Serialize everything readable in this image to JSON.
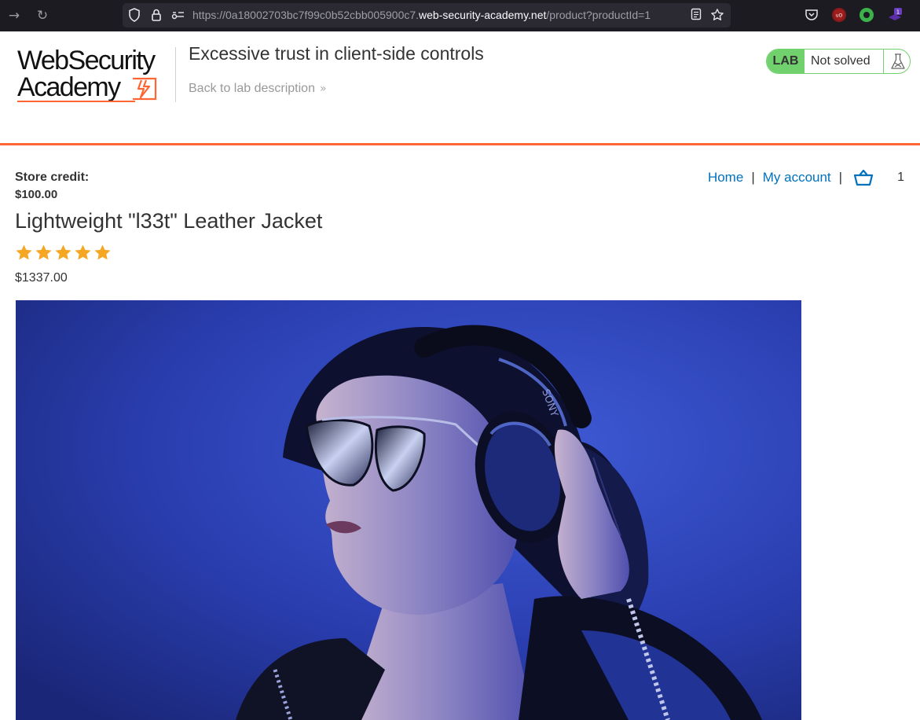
{
  "browser": {
    "url_prefix": "https://0a18002703bc7f99c0b52cbb005900c7.",
    "url_domain": "web-security-academy.net",
    "url_path": "/product?productId=1",
    "extension_badge": "1"
  },
  "header": {
    "logo_line1": "WebSecurity",
    "logo_line2": "Academy",
    "lab_title": "Excessive trust in client-side controls",
    "back_link": "Back to lab description",
    "lab_label": "LAB",
    "lab_status": "Not solved"
  },
  "account": {
    "credit_label": "Store credit:",
    "credit_value": "$100.00"
  },
  "nav": {
    "home": "Home",
    "separator": "|",
    "my_account": "My account",
    "cart_count": "1"
  },
  "product": {
    "title": "Lightweight \"l33t\" Leather Jacket",
    "rating": 5,
    "rating_max": 5,
    "price": "$1337.00",
    "headphone_brand": "SONY"
  },
  "colors": {
    "accent": "#ff6633",
    "link": "#0071bc",
    "lab_green": "#70d16d",
    "star": "#f5a623"
  }
}
